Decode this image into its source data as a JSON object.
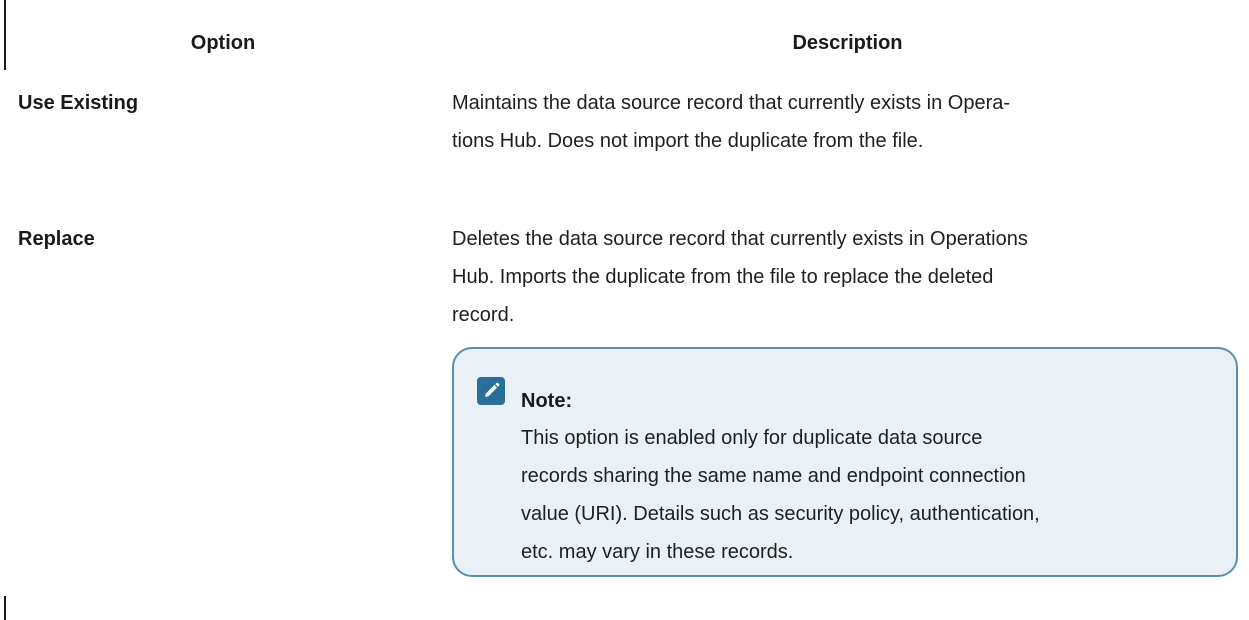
{
  "table": {
    "headers": {
      "option": "Option",
      "description": "Description"
    },
    "rows": [
      {
        "option": "Use Existing",
        "description_lines": [
          "Maintains the data source record that currently exists in Opera-",
          "tions Hub. Does not import the duplicate from the file."
        ]
      },
      {
        "option": "Replace",
        "description_lines": [
          "Deletes the data source record that currently exists in Operations",
          "Hub. Imports the duplicate from the file to replace the deleted",
          "record."
        ],
        "note": {
          "icon": "pencil-note-icon",
          "title": "Note:",
          "body_lines": [
            "This option is enabled only for duplicate data source",
            "records sharing the same name and endpoint connection",
            "value (URI). Details such as security policy, authentication,",
            "etc. may vary in these records."
          ]
        }
      }
    ]
  },
  "colors": {
    "note_background": "#e9f1f6",
    "note_border": "#5b8fb0",
    "note_icon": "#2a6f9a"
  }
}
